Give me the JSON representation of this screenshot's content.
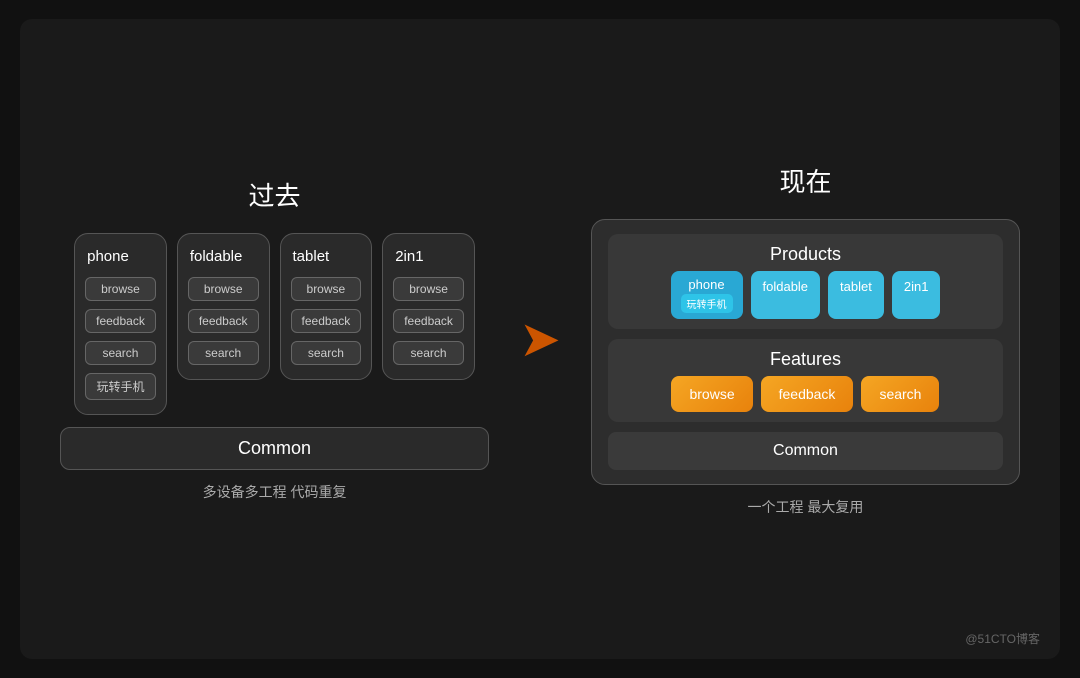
{
  "slide": {
    "background": "#1a1a1a"
  },
  "past": {
    "title": "过去",
    "subtitle": "多设备多工程 代码重复",
    "common_label": "Common",
    "devices": [
      {
        "name": "phone",
        "features": [
          "browse",
          "feedback",
          "search",
          "玩转手机"
        ]
      },
      {
        "name": "foldable",
        "features": [
          "browse",
          "feedback",
          "search"
        ]
      },
      {
        "name": "tablet",
        "features": [
          "browse",
          "feedback",
          "search"
        ]
      },
      {
        "name": "2in1",
        "features": [
          "browse",
          "feedback",
          "search"
        ]
      }
    ]
  },
  "arrow": "→",
  "present": {
    "title": "现在",
    "subtitle": "一个工程 最大复用",
    "products_label": "Products",
    "features_label": "Features",
    "common_label": "Common",
    "products": [
      "phone\n玩转手机",
      "foldable",
      "tablet",
      "2in1"
    ],
    "features": [
      "browse",
      "feedback",
      "search"
    ]
  },
  "watermark": "@51CTO博客"
}
